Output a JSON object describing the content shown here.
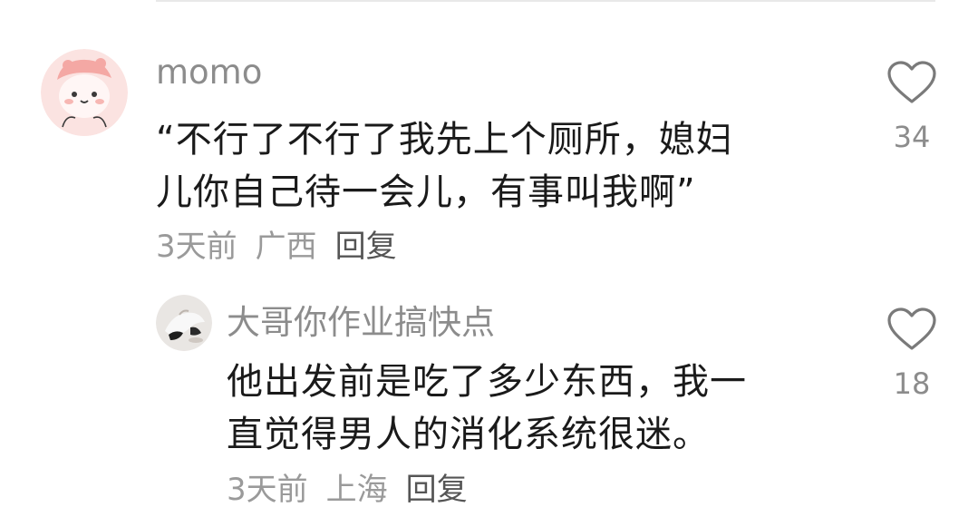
{
  "comments": [
    {
      "username": "momo",
      "text_lines": [
        "“不行了不行了我先上个厕所，媳妇",
        "儿你自己待一会儿，有事叫我啊”"
      ],
      "time": "3天前",
      "location": "广西",
      "reply_label": "回复",
      "likes": "34",
      "avatar_icon": "pink-bun-cartoon-avatar"
    },
    {
      "username": "大哥你作业搞快点",
      "text_lines": [
        "他出发前是吃了多少东西，我一",
        "直觉得男人的消化系统很迷。"
      ],
      "time": "3天前",
      "location": "上海",
      "reply_label": "回复",
      "likes": "18",
      "avatar_icon": "photo-avatar"
    }
  ],
  "icons": {
    "like": "heart-outline-icon"
  },
  "colors": {
    "username": "#8c8c8c",
    "text": "#1a1a1a",
    "meta": "#9a9a9a",
    "icon": "#7a7a7a"
  }
}
